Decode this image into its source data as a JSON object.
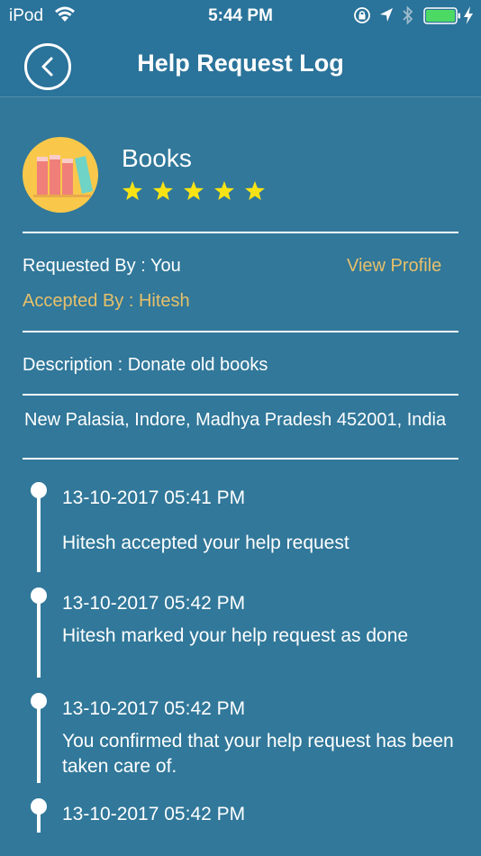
{
  "status_bar": {
    "carrier": "iPod",
    "time": "5:44 PM"
  },
  "nav": {
    "title": "Help Request Log",
    "back_icon": "chevron-left-icon"
  },
  "request": {
    "category": "Books",
    "rating": 5,
    "requested_by": "Requested By : You",
    "view_profile": "View Profile",
    "accepted_by": "Accepted By : Hitesh",
    "description": "Description : Donate old books",
    "address": "New Palasia, Indore, Madhya Pradesh 452001, India"
  },
  "timeline": [
    {
      "date": "13-10-2017 05:41 PM",
      "message": "Hitesh accepted your help request"
    },
    {
      "date": "13-10-2017 05:42 PM",
      "message": "Hitesh marked your help request as done"
    },
    {
      "date": "13-10-2017 05:42 PM",
      "message": "You confirmed that your help request has been taken care of."
    },
    {
      "date": "13-10-2017 05:42 PM",
      "message": ""
    }
  ],
  "colors": {
    "background": "#31789a",
    "header": "#2a739a",
    "accent_yellow": "#e6c06b",
    "star": "#f7e315",
    "battery": "#4cd964"
  }
}
